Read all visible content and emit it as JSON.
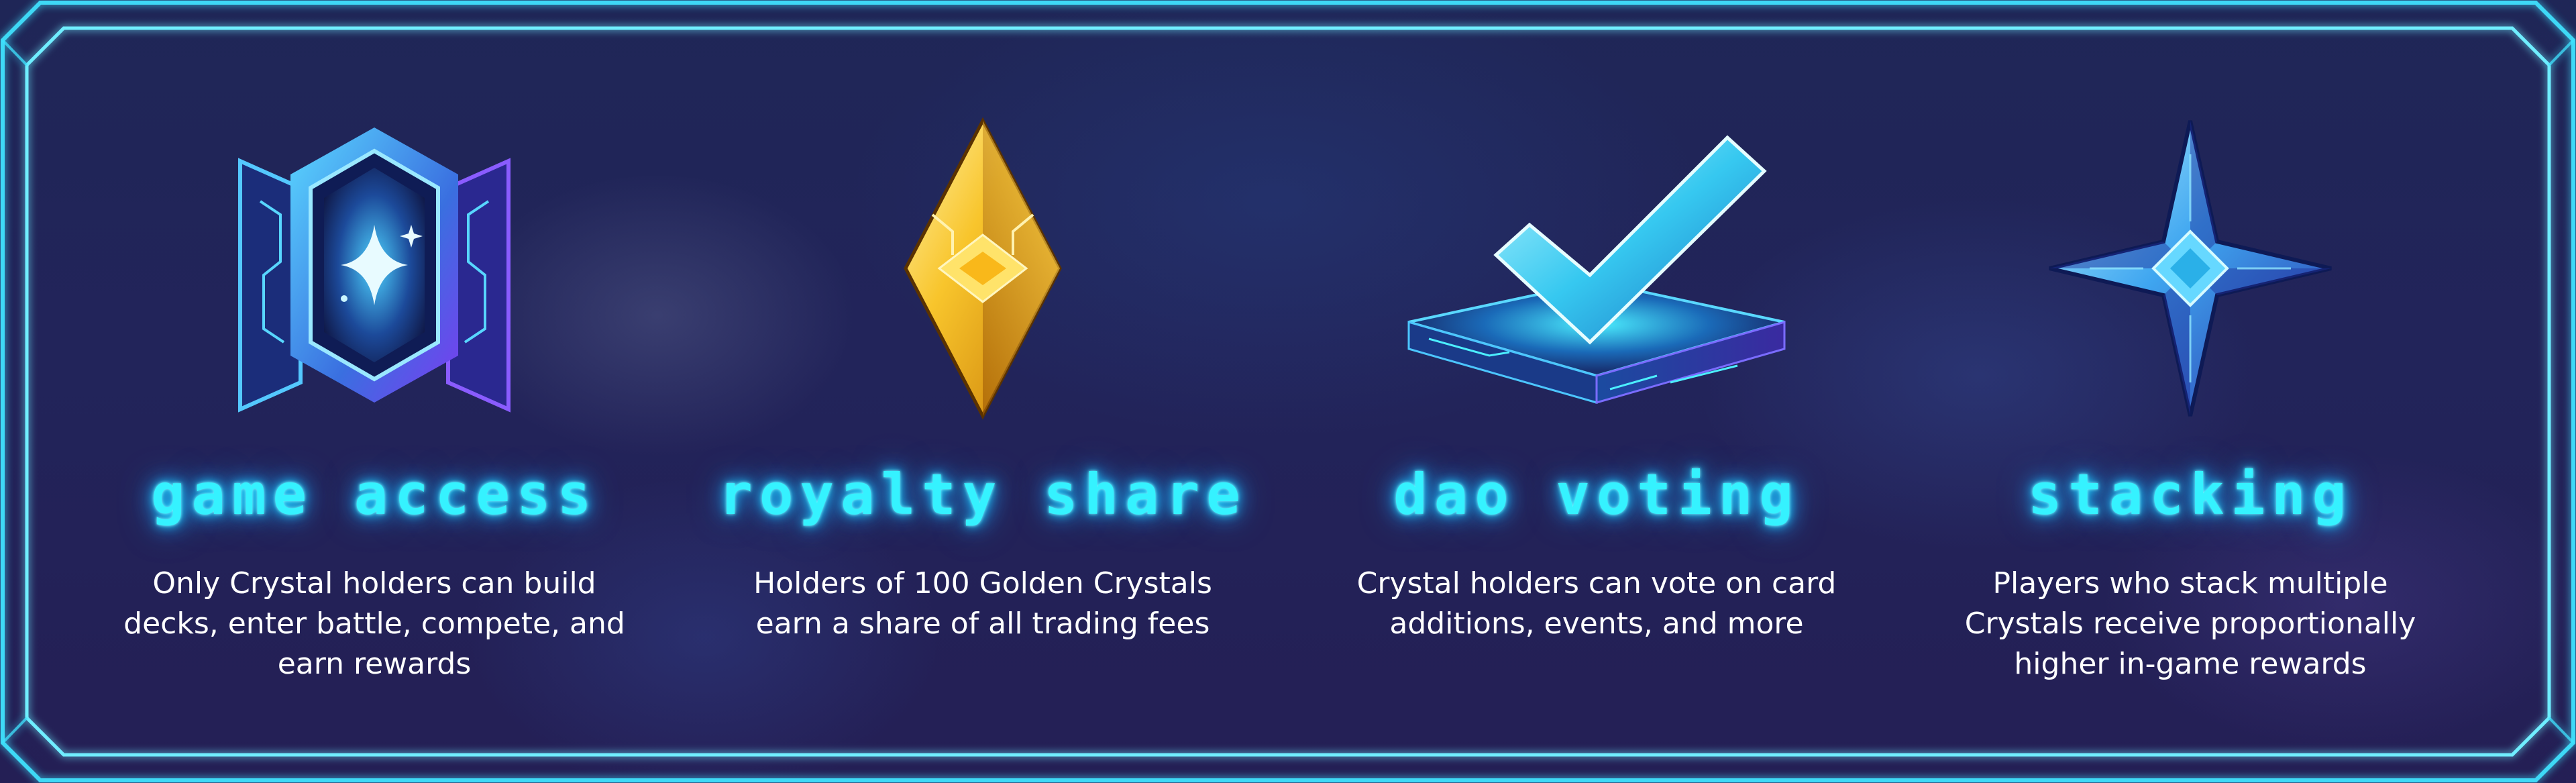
{
  "features": [
    {
      "id": "game-access",
      "icon": "crystal-shield-icon",
      "title": "Game Access",
      "description": "Only Crystal holders can build decks, enter battle, compete, and earn rewards"
    },
    {
      "id": "royalty-share",
      "icon": "golden-crystal-icon",
      "title": "Royalty Share",
      "description": "Holders of 100 Golden Crystals earn a share of all trading fees"
    },
    {
      "id": "dao-voting",
      "icon": "checkmark-platform-icon",
      "title": "DAO Voting",
      "description": "Crystal holders can vote on card additions, events, and more"
    },
    {
      "id": "stacking",
      "icon": "four-point-star-crystal-icon",
      "title": "Stacking",
      "description": "Players who stack multiple Crystals receive proportionally higher in-game rewards"
    }
  ],
  "colors": {
    "frame_glow": "#3fe3ff",
    "title_glow": "#35f2ff",
    "background": "#1f2657",
    "text": "#ffffff",
    "gold": "#f6b21c"
  }
}
